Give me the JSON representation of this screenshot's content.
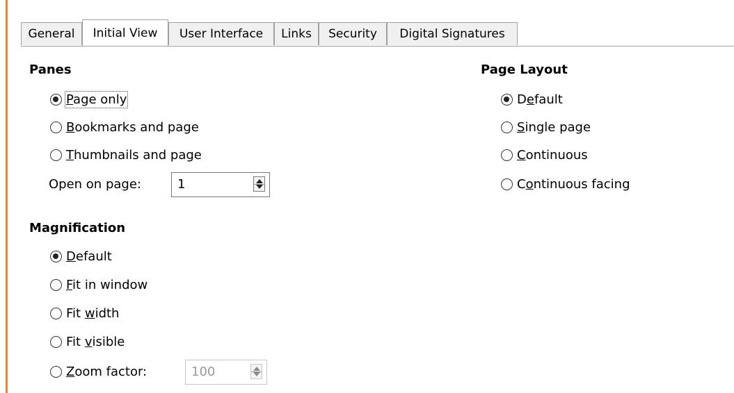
{
  "tabs": [
    {
      "label": "General"
    },
    {
      "label": "Initial View"
    },
    {
      "label": "User Interface"
    },
    {
      "label": "Links"
    },
    {
      "label": "Security"
    },
    {
      "label": "Digital Signatures"
    }
  ],
  "active_tab": "Initial View",
  "panes": {
    "heading": "Panes",
    "options": [
      {
        "pre": "",
        "u": "P",
        "post": "age only",
        "checked": true
      },
      {
        "pre": "",
        "u": "B",
        "post": "ookmarks and page",
        "checked": false
      },
      {
        "pre": "",
        "u": "T",
        "post": "humbnails and page",
        "checked": false
      }
    ],
    "open_on_page": {
      "pre": "Open on pa",
      "u": "g",
      "post": "e:",
      "value": "1"
    }
  },
  "magnification": {
    "heading": "Magnification",
    "options": [
      {
        "pre": "",
        "u": "D",
        "post": "efault",
        "checked": true
      },
      {
        "pre": "",
        "u": "F",
        "post": "it in window",
        "checked": false
      },
      {
        "pre": "Fit ",
        "u": "w",
        "post": "idth",
        "checked": false
      },
      {
        "pre": "Fit ",
        "u": "v",
        "post": "isible",
        "checked": false
      },
      {
        "pre": "",
        "u": "Z",
        "post": "oom factor:",
        "checked": false
      }
    ],
    "zoom_value": "100"
  },
  "page_layout": {
    "heading": "Page Layout",
    "options": [
      {
        "pre": "D",
        "u": "e",
        "post": "fault",
        "checked": true
      },
      {
        "pre": "",
        "u": "S",
        "post": "ingle page",
        "checked": false
      },
      {
        "pre": "",
        "u": "C",
        "post": "ontinuous",
        "checked": false
      },
      {
        "pre": "C",
        "u": "o",
        "post": "ntinuous facing",
        "checked": false
      }
    ]
  },
  "colors": {
    "accent": "#e8872e",
    "border": "#a0a0a0",
    "tab_bg": "#f0f0f0"
  }
}
